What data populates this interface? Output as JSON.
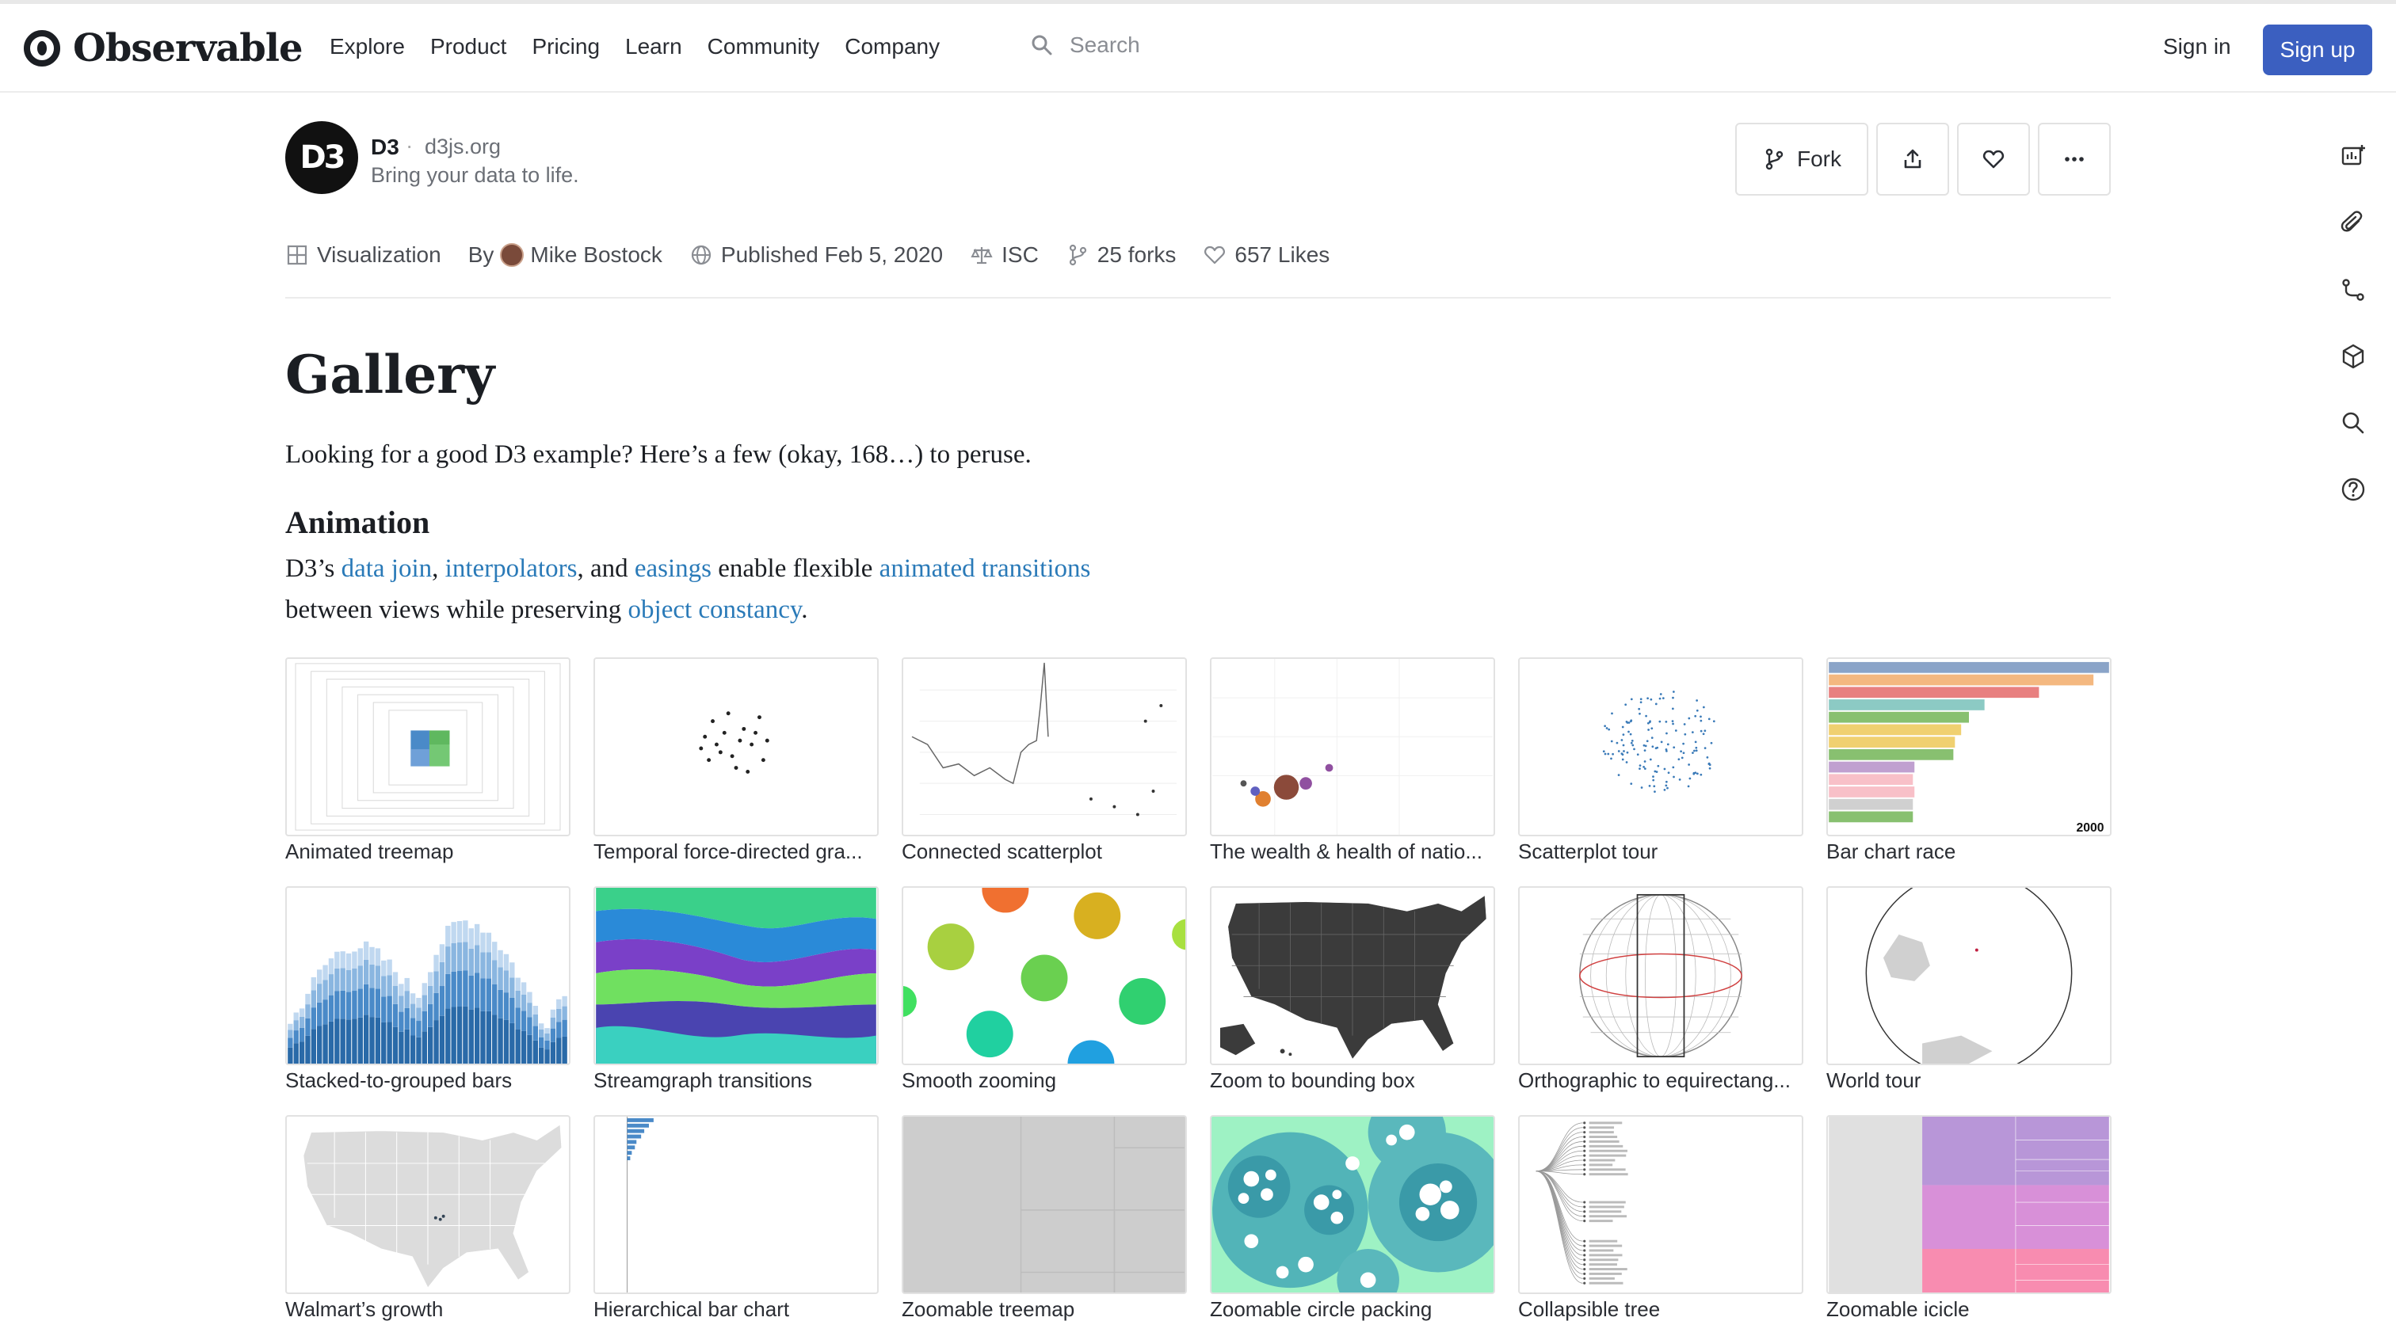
{
  "nav": {
    "brand": "Observable",
    "links": [
      "Explore",
      "Product",
      "Pricing",
      "Learn",
      "Community",
      "Company"
    ],
    "search_placeholder": "Search",
    "signin": "Sign in",
    "signup": "Sign up"
  },
  "notebook": {
    "logo_text": "D3",
    "title": "D3",
    "separator": "·",
    "site": "d3js.org",
    "tagline": "Bring your data to life.",
    "actions": {
      "fork": "Fork",
      "share_icon": "share-icon",
      "like_icon": "heart-icon",
      "more_icon": "more-icon"
    },
    "meta": {
      "type": "Visualization",
      "by_label": "By",
      "author": "Mike Bostock",
      "published": "Published Feb 5, 2020",
      "license": "ISC",
      "forks": "25 forks",
      "likes": "657 Likes"
    }
  },
  "content": {
    "heading": "Gallery",
    "intro": "Looking for a good D3 example? Here’s a few (okay, 168…) to peruse.",
    "section_heading": "Animation",
    "section_text": {
      "p1": "D3’s ",
      "link1": "data join",
      "p2": ", ",
      "link2": "interpolators",
      "p3": ", and ",
      "link3": "easings",
      "p4": " enable flexible ",
      "link4": "animated transitions",
      "p5": "between views while preserving ",
      "link5": "object constancy",
      "p6": "."
    }
  },
  "gallery": [
    "Animated treemap",
    "Temporal force-directed gra...",
    "Connected scatterplot",
    "The wealth & health of natio...",
    "Scatterplot tour",
    "Bar chart race",
    "Stacked-to-grouped bars",
    "Streamgraph transitions",
    "Smooth zooming",
    "Zoom to bounding box",
    "Orthographic to equirectang...",
    "World tour",
    "Walmart’s growth",
    "Hierarchical bar chart",
    "Zoomable treemap",
    "Zoomable circle packing",
    "Collapsible tree",
    "Zoomable icicle"
  ],
  "bar_race_year": "2000",
  "sidebar_icons": [
    "add-cell-icon",
    "attachment-icon",
    "branch-icon",
    "package-icon",
    "search-icon",
    "help-icon"
  ],
  "colors": {
    "brand_button": "#3b5fc0",
    "link": "#2a7ab8"
  }
}
